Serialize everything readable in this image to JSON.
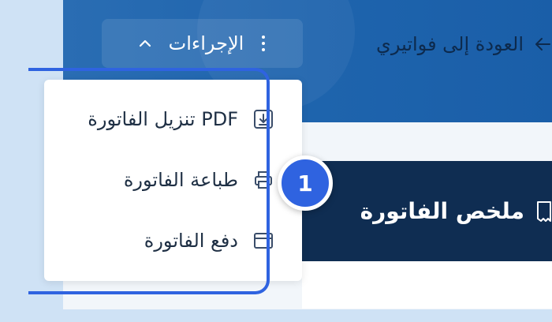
{
  "header": {
    "back_label": "العودة إلى فواتيري",
    "back_icon": "arrow-left-icon"
  },
  "actions": {
    "label": "الإجراءات",
    "chevron_icon": "chevron-up-icon",
    "kebab_icon": "kebab-vertical-icon"
  },
  "menu": {
    "items": [
      {
        "label": "تنزيل الفاتورة PDF",
        "icon": "download-file-icon"
      },
      {
        "label": "طباعة الفاتورة",
        "icon": "printer-icon"
      },
      {
        "label": "دفع الفاتورة",
        "icon": "credit-card-icon"
      }
    ]
  },
  "summary": {
    "title": "ملخص الفاتورة",
    "icon": "receipt-icon"
  },
  "step_badge": {
    "number": "1"
  },
  "colors": {
    "header": "#1e64ad",
    "summary_bar": "#0f2d52",
    "highlight": "#2f63e0",
    "page_bg": "#cfe2f5"
  }
}
